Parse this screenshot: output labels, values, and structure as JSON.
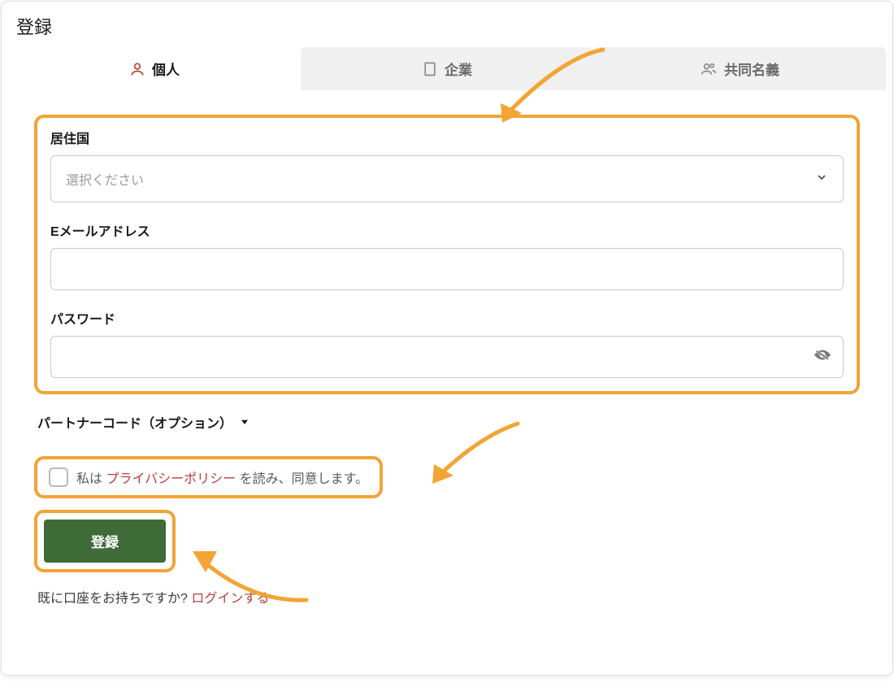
{
  "header": {
    "title": "登録"
  },
  "tabs": [
    {
      "label": "個人",
      "active": true,
      "icon": "person"
    },
    {
      "label": "企業",
      "active": false,
      "icon": "building"
    },
    {
      "label": "共同名義",
      "active": false,
      "icon": "people"
    }
  ],
  "form": {
    "country": {
      "label": "居住国",
      "placeholder": "選択ください"
    },
    "email": {
      "label": "Eメールアドレス",
      "value": ""
    },
    "password": {
      "label": "パスワード",
      "value": ""
    },
    "partner_code": {
      "label": "パートナーコード（オプション）"
    },
    "consent": {
      "prefix": "私は ",
      "link": "プライバシーポリシー",
      "suffix": " を読み、同意します。"
    },
    "submit_label": "登録",
    "footer": {
      "text": "既に口座をお持ちですか? ",
      "link": "ログインする"
    }
  }
}
